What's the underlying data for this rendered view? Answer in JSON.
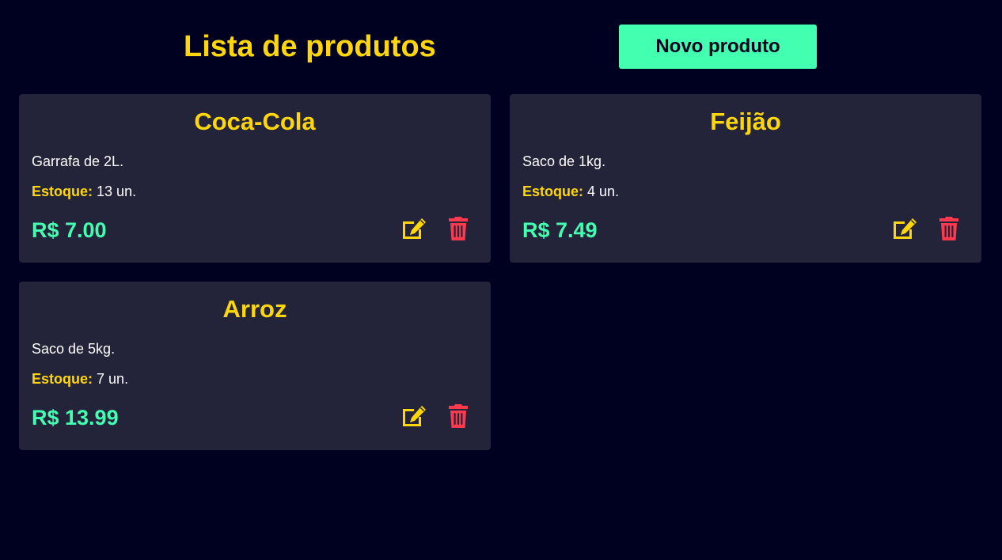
{
  "header": {
    "title": "Lista de produtos",
    "new_button_label": "Novo produto"
  },
  "colors": {
    "background": "#000020",
    "card": "#23233a",
    "accent_yellow": "#ffd60a",
    "accent_green": "#43ffb0",
    "danger_red": "#ff3a4f"
  },
  "icons": {
    "edit": "edit-icon",
    "delete": "trash-icon"
  },
  "products": [
    {
      "name": "Coca-Cola",
      "description": "Garrafa de 2L.",
      "stock_label": "Estoque:",
      "stock_value": "13 un.",
      "price": "R$ 7.00"
    },
    {
      "name": "Feijão",
      "description": "Saco de 1kg.",
      "stock_label": "Estoque:",
      "stock_value": "4 un.",
      "price": "R$ 7.49"
    },
    {
      "name": "Arroz",
      "description": "Saco de 5kg.",
      "stock_label": "Estoque:",
      "stock_value": "7 un.",
      "price": "R$ 13.99"
    }
  ]
}
